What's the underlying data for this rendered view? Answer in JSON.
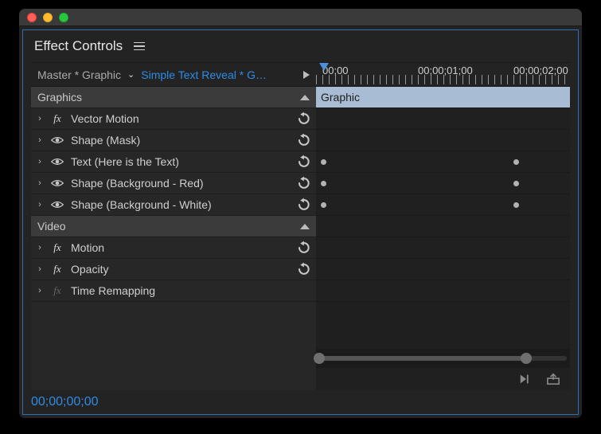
{
  "panel": {
    "title": "Effect Controls"
  },
  "breadcrumb": {
    "master": "Master * Graphic",
    "clip": "Simple Text Reveal * G…"
  },
  "groups": {
    "graphics": "Graphics",
    "video": "Video"
  },
  "graphics_items": [
    {
      "icon": "fx",
      "label": "Vector Motion",
      "reset": true,
      "kf": []
    },
    {
      "icon": "eye",
      "label": "Shape (Mask)",
      "reset": true,
      "kf": []
    },
    {
      "icon": "eye",
      "label": "Text (Here is the Text)",
      "reset": true,
      "kf": [
        6,
        248
      ]
    },
    {
      "icon": "eye",
      "label": "Shape (Background - Red)",
      "reset": true,
      "kf": [
        6,
        248
      ]
    },
    {
      "icon": "eye",
      "label": "Shape (Background - White)",
      "reset": true,
      "kf": [
        6,
        248
      ]
    }
  ],
  "video_items": [
    {
      "icon": "fx",
      "label": "Motion",
      "reset": true
    },
    {
      "icon": "fx",
      "label": "Opacity",
      "reset": true
    },
    {
      "icon": "fx-dim",
      "label": "Time Remapping",
      "reset": false
    }
  ],
  "timeline": {
    "ruler": [
      "00;00",
      "00;00;01;00",
      "00;00;02;00"
    ],
    "track_label": "Graphic",
    "current_tc": "00;00;00;00"
  }
}
